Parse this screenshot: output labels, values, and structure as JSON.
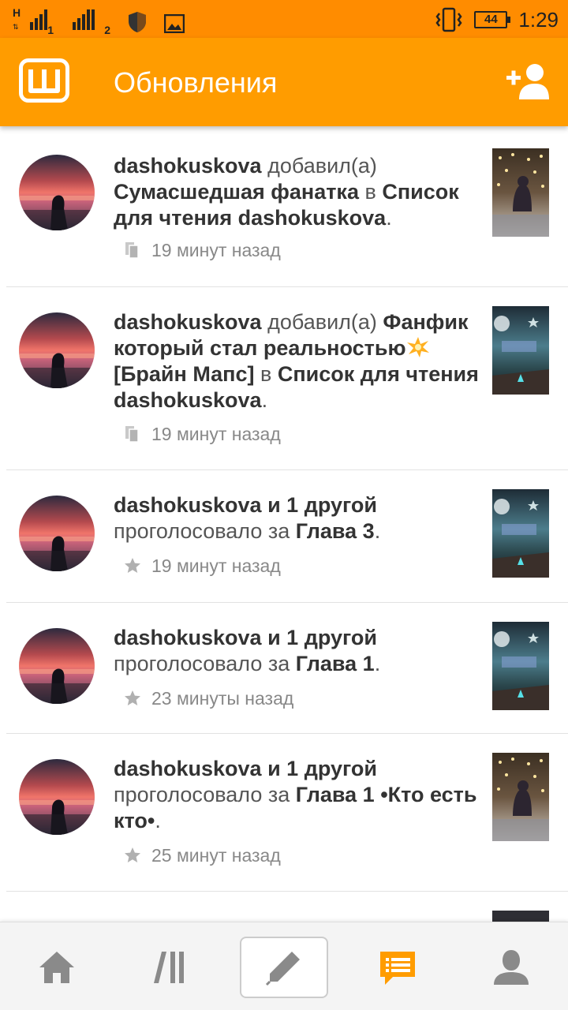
{
  "status_bar": {
    "sim1_network_letter": "H",
    "sim1_index": "1",
    "sim2_index": "2",
    "battery_level": "44",
    "time": "1:29"
  },
  "header": {
    "logo_letter": "ш",
    "title": "Обновления"
  },
  "feed": [
    {
      "actor": "dashokuskova",
      "verb": "добавил(а)",
      "object": "Сумасшедшая фанатка",
      "connector": "в",
      "target": "Список для чтения dashokuskova",
      "end": ".",
      "icon": "library-icon",
      "time": "19 минут назад"
    },
    {
      "actor": "dashokuskova",
      "verb": "добавил(а)",
      "object": "Фанфик который стал реальностью",
      "object_suffix": "[Брайн Мапс]",
      "emoji": "collision-emoji",
      "connector": "в",
      "target": "Список для чтения dashokuskova",
      "end": ".",
      "icon": "library-icon",
      "time": "19 минут назад"
    },
    {
      "actor": "dashokuskova и 1 другой",
      "verb": "проголосовало за",
      "object": "Глава 3",
      "end": ".",
      "icon": "star-icon",
      "time": "19 минут назад"
    },
    {
      "actor": "dashokuskova и 1 другой",
      "verb": "проголосовало за",
      "object": "Глава 1",
      "end": ".",
      "icon": "star-icon",
      "time": "23 минуты назад"
    },
    {
      "actor": "dashokuskova и 1 другой",
      "verb": "проголосовало за",
      "object": "Глава 1 •Кто есть кто•",
      "end": ".",
      "icon": "star-icon",
      "time": "25 минут назад"
    }
  ],
  "bottom_nav": {
    "items": [
      "home-icon",
      "library-icon",
      "write-icon",
      "updates-icon",
      "profile-icon"
    ],
    "active": "updates-icon"
  },
  "colors": {
    "status_bar": "#ff8c00",
    "app_bar": "#ff9c00",
    "active_nav": "#ff9c00",
    "inactive_nav": "#8a8a8a"
  }
}
